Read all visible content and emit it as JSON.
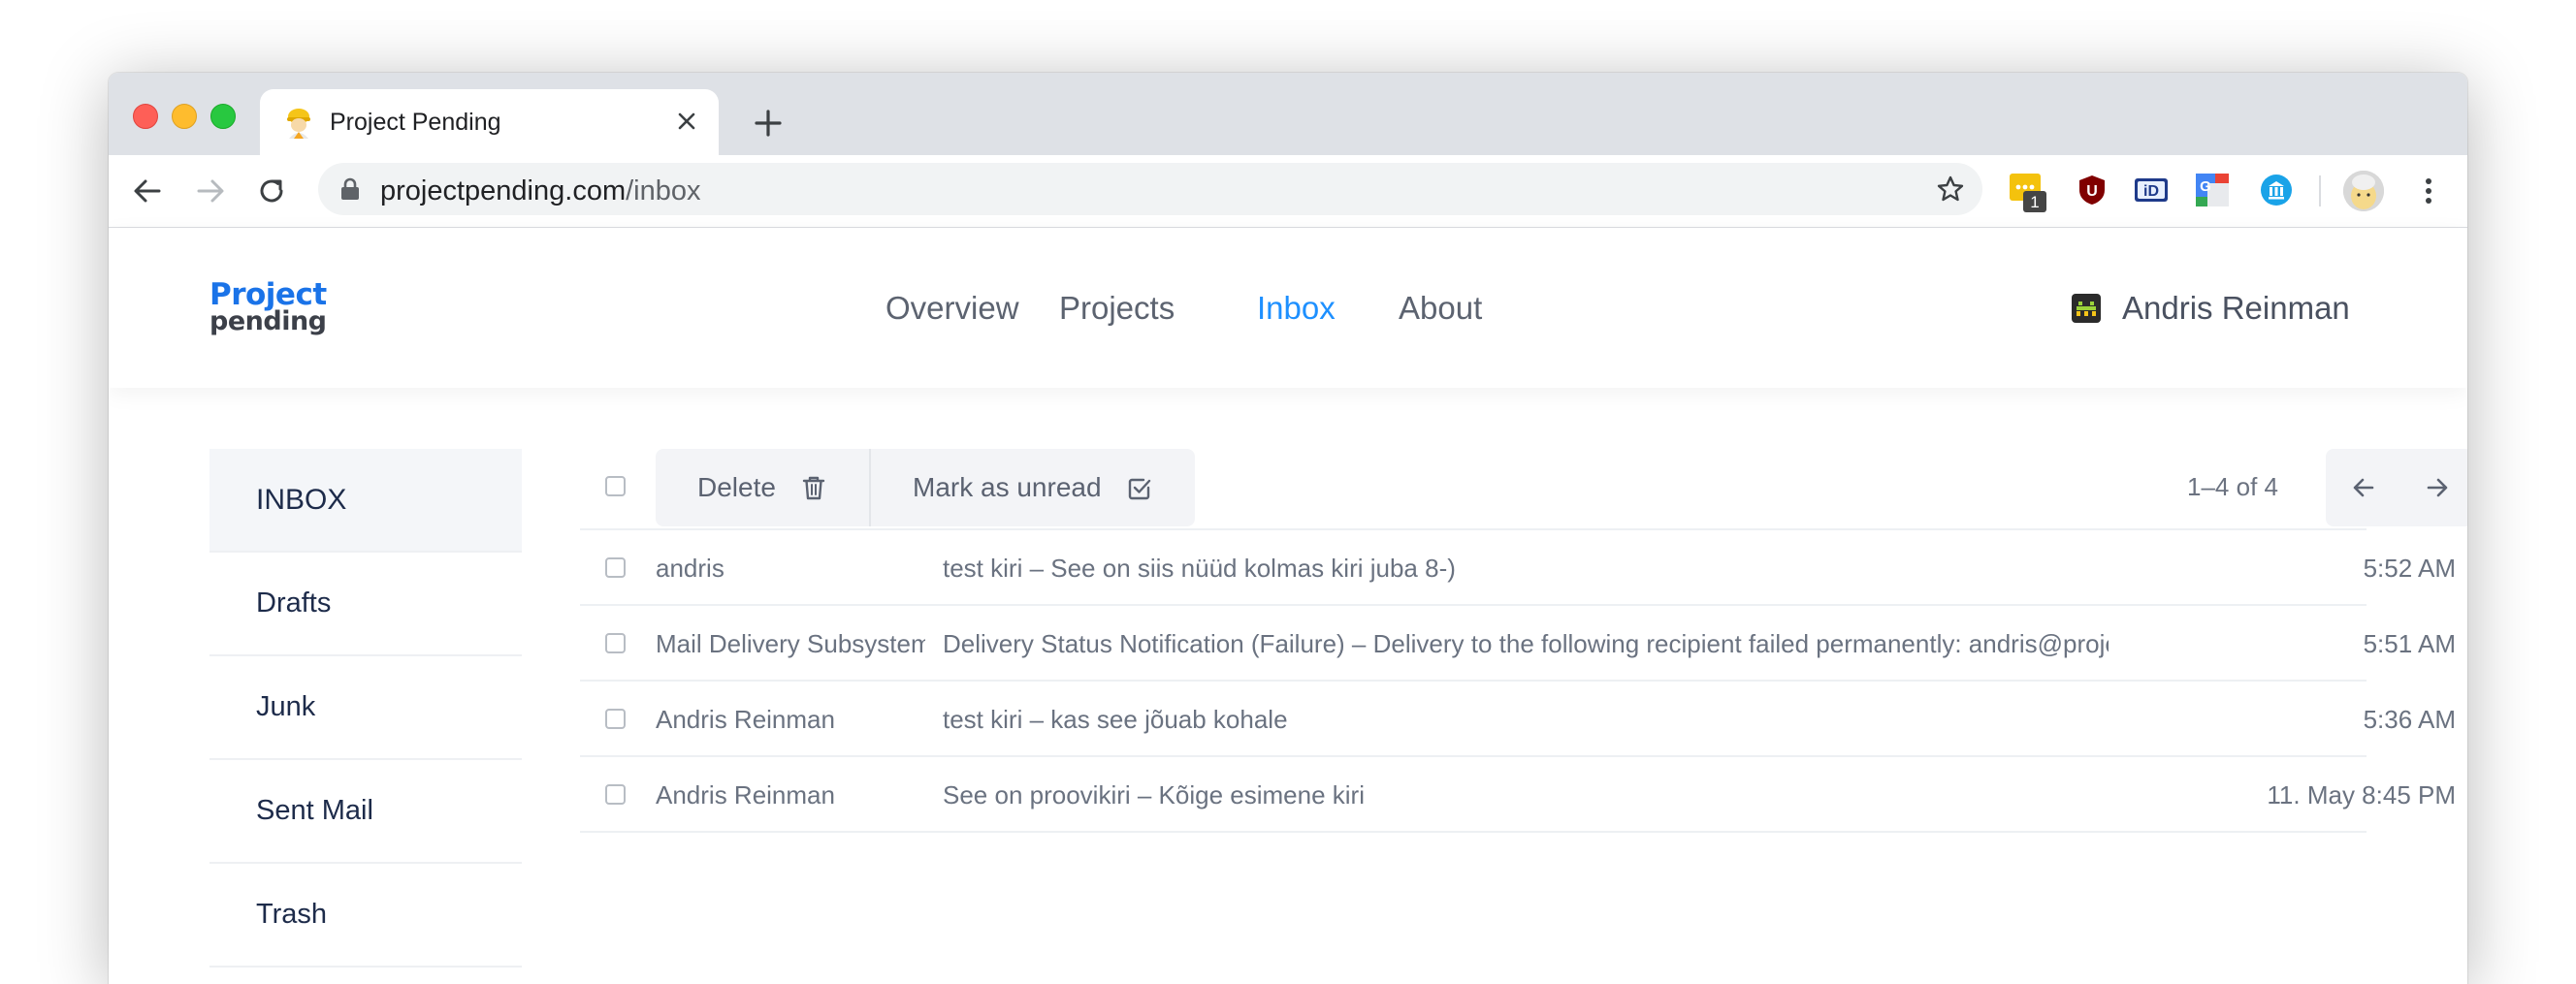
{
  "browser": {
    "tab_title": "Project Pending",
    "url_domain": "projectpending.com",
    "url_path": "/inbox"
  },
  "site": {
    "logo_top": "Project",
    "logo_bottom": "pending",
    "nav": [
      "Overview",
      "Projects",
      "Inbox",
      "About"
    ],
    "active_nav": "Inbox",
    "user_name": "Andris Reinman"
  },
  "sidebar": {
    "folders": [
      "INBOX",
      "Drafts",
      "Junk",
      "Sent Mail",
      "Trash"
    ],
    "active_folder": "INBOX"
  },
  "toolbar": {
    "delete_label": "Delete",
    "mark_unread_label": "Mark as unread",
    "pagination": "1–4 of 4"
  },
  "messages": [
    {
      "sender": "andris",
      "subject": "test kiri – See on siis nüüd kolmas kiri juba 8-)",
      "time": "5:52 AM"
    },
    {
      "sender": "Mail Delivery Subsystem",
      "subject": "Delivery Status Notification (Failure) – Delivery to the following recipient failed permanently: andris@projectpending.com",
      "time": "5:51 AM"
    },
    {
      "sender": "Andris Reinman",
      "subject": "test kiri – kas see jõuab kohale",
      "time": "5:36 AM"
    },
    {
      "sender": "Andris Reinman",
      "subject": "See on proovikiri – Kõige esimene kiri",
      "time": "11. May 8:45 PM"
    }
  ],
  "extensions": {
    "badge_count": "1",
    "ublock_letter": "U",
    "id_label": "iD"
  },
  "colors": {
    "accent": "#1e90ff",
    "logo_blue": "#1a73e8",
    "folder_text": "#1d2b4a",
    "muted_text": "#6a7280"
  }
}
